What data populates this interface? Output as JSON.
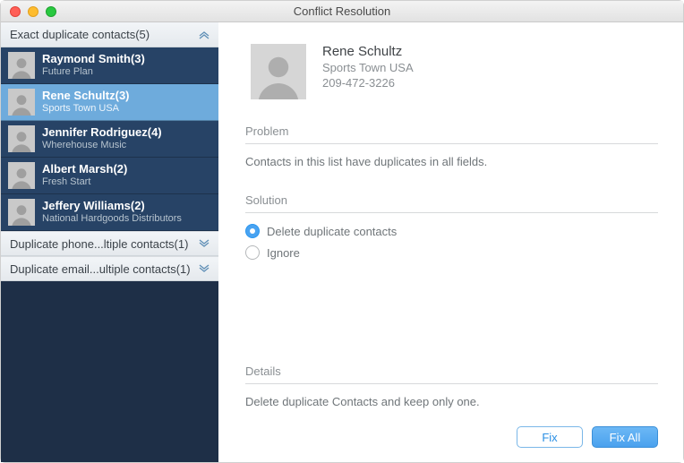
{
  "window": {
    "title": "Conflict Resolution"
  },
  "sidebar": {
    "categories": [
      {
        "label": "Exact duplicate contacts(5)",
        "expanded": true,
        "items": [
          {
            "name": "Raymond Smith(3)",
            "company": "Future Plan",
            "selected": false
          },
          {
            "name": "Rene Schultz(3)",
            "company": "Sports Town USA",
            "selected": true
          },
          {
            "name": "Jennifer Rodriguez(4)",
            "company": "Wherehouse Music",
            "selected": false
          },
          {
            "name": "Albert Marsh(2)",
            "company": "Fresh Start",
            "selected": false
          },
          {
            "name": "Jeffery Williams(2)",
            "company": "National Hardgoods Distributors",
            "selected": false
          }
        ]
      },
      {
        "label": "Duplicate phone...ltiple contacts(1)",
        "expanded": false,
        "items": []
      },
      {
        "label": "Duplicate email...ultiple contacts(1)",
        "expanded": false,
        "items": []
      }
    ]
  },
  "detail": {
    "contact": {
      "name": "Rene Schultz",
      "company": "Sports Town USA",
      "phone": "209-472-3226"
    },
    "sections": {
      "problem_label": "Problem",
      "problem_text": "Contacts in this list have duplicates in all fields.",
      "solution_label": "Solution",
      "options": [
        {
          "label": "Delete duplicate contacts",
          "checked": true
        },
        {
          "label": "Ignore",
          "checked": false
        }
      ],
      "details_label": "Details",
      "details_text": "Delete duplicate Contacts and keep only one."
    },
    "buttons": {
      "fix": "Fix",
      "fix_all": "Fix All"
    }
  }
}
